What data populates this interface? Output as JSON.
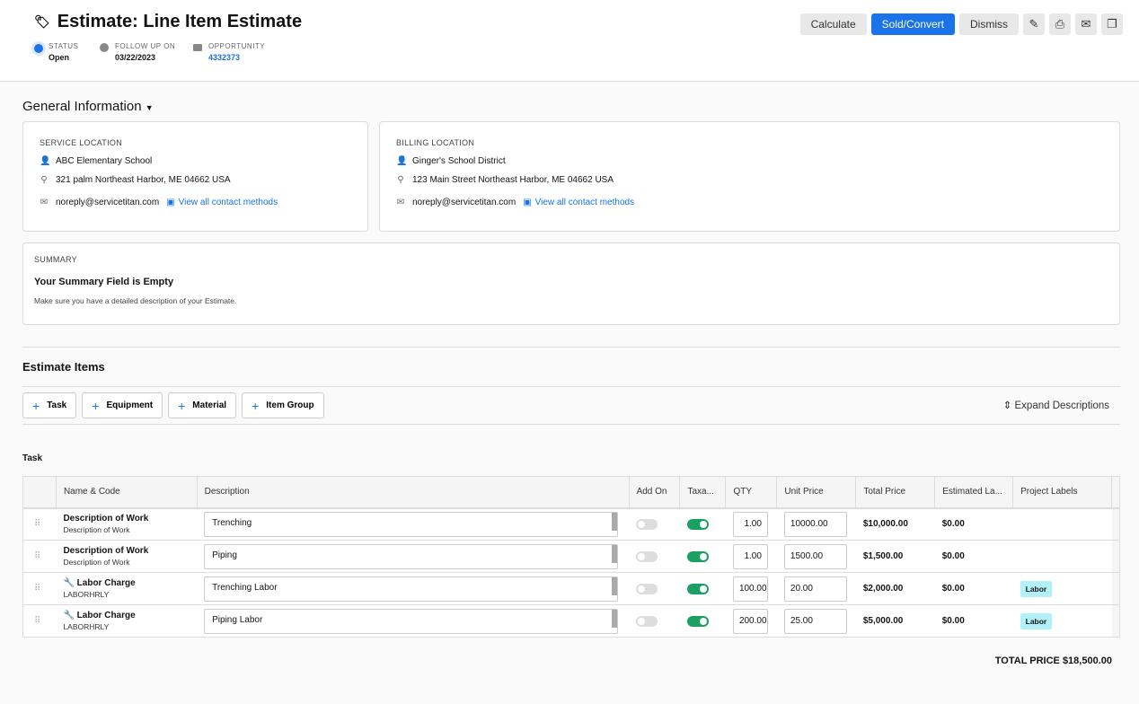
{
  "header": {
    "title": "Estimate: Line Item Estimate",
    "status": {
      "label": "STATUS",
      "value": "Open"
    },
    "follow_up": {
      "label": "FOLLOW UP ON",
      "value": "03/22/2023"
    },
    "opportunity": {
      "label": "OPPORTUNITY",
      "value": "4332373"
    },
    "actions": {
      "calculate": "Calculate",
      "sold": "Sold/Convert",
      "dismiss": "Dismiss"
    }
  },
  "general": {
    "title": "General Information",
    "service": {
      "label": "SERVICE LOCATION",
      "name": "ABC Elementary School",
      "address": "321 palm Northeast Harbor, ME 04662 USA",
      "email": "noreply@servicetitan.com",
      "link": "View all contact methods"
    },
    "billing": {
      "label": "BILLING LOCATION",
      "name": "Ginger's School District",
      "address": "123 Main Street Northeast Harbor, ME 04662 USA",
      "email": "noreply@servicetitan.com",
      "link": "View all contact methods"
    },
    "summary": {
      "label": "SUMMARY",
      "heading": "Your Summary Field is Empty",
      "text": "Make sure you have a detailed description of your Estimate."
    }
  },
  "items": {
    "title": "Estimate Items",
    "add": [
      "Task",
      "Equipment",
      "Material",
      "Item Group"
    ],
    "expand": "Expand Descriptions",
    "section": "Task",
    "columns": [
      "Name & Code",
      "Description",
      "Add On",
      "Taxa...",
      "QTY",
      "Unit Price",
      "Total Price",
      "Estimated La...",
      "Project Labels"
    ],
    "rows": [
      {
        "name": "Description of Work",
        "code": "Description of Work",
        "desc": "Trenching",
        "add_on": false,
        "taxable": true,
        "qty": "1.00",
        "unit": "10000.00",
        "total": "$10,000.00",
        "est": "$0.00",
        "label": ""
      },
      {
        "name": "Description of Work",
        "code": "Description of Work",
        "desc": "Piping",
        "add_on": false,
        "taxable": true,
        "qty": "1.00",
        "unit": "1500.00",
        "total": "$1,500.00",
        "est": "$0.00",
        "label": ""
      },
      {
        "name": "Labor Charge",
        "code": "LABORHRLY",
        "desc": "Trenching Labor",
        "add_on": false,
        "taxable": true,
        "qty": "100.00",
        "unit": "20.00",
        "total": "$2,000.00",
        "est": "$0.00",
        "label": "Labor",
        "icon": "wrench-icon"
      },
      {
        "name": "Labor Charge",
        "code": "LABORHRLY",
        "desc": "Piping Labor",
        "add_on": false,
        "taxable": true,
        "qty": "200.00",
        "unit": "25.00",
        "total": "$5,000.00",
        "est": "$0.00",
        "label": "Labor",
        "icon": "wrench-icon"
      }
    ],
    "total": "TOTAL PRICE $18,500.00"
  },
  "colors": {
    "accent": "#1a73e8",
    "toggle_on": "#1aa060",
    "label_tag": "#b2f1fa"
  }
}
